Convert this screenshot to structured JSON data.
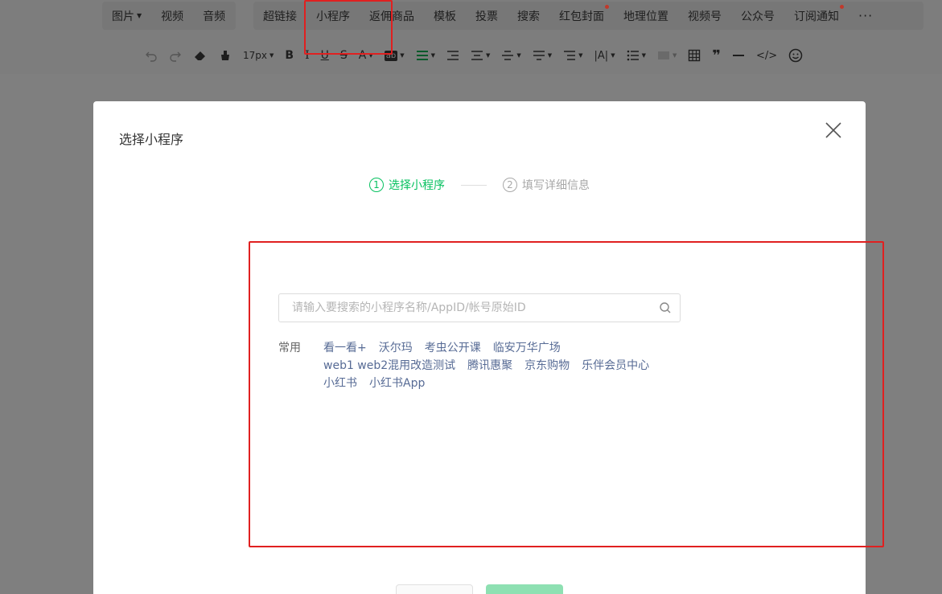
{
  "toolbar": {
    "group1": [
      {
        "label": "图片",
        "has_caret": true
      },
      {
        "label": "视频"
      },
      {
        "label": "音频"
      }
    ],
    "group2": [
      {
        "label": "超链接"
      },
      {
        "label": "小程序"
      },
      {
        "label": "返佣商品"
      },
      {
        "label": "模板"
      },
      {
        "label": "投票"
      },
      {
        "label": "搜索"
      },
      {
        "label": "红包封面",
        "has_dot": true
      },
      {
        "label": "地理位置"
      },
      {
        "label": "视频号"
      },
      {
        "label": "公众号"
      },
      {
        "label": "订阅通知",
        "has_dot": true
      }
    ],
    "more_icon": "more-icon",
    "font_size": "17px"
  },
  "modal": {
    "title": "选择小程序",
    "steps": [
      {
        "num": "1",
        "label": "选择小程序",
        "state": "active"
      },
      {
        "num": "2",
        "label": "填写详细信息",
        "state": "inactive"
      }
    ],
    "search": {
      "placeholder": "请输入要搜索的小程序名称/AppID/帐号原始ID",
      "value": ""
    },
    "recent": {
      "label": "常用",
      "items": [
        "看一看+",
        "沃尔玛",
        "考虫公开课",
        "临安万华广场",
        "web1 web2混用改造测试",
        "腾讯惠聚",
        "京东购物",
        "乐伴会员中心",
        "小红书",
        "小红书App"
      ]
    }
  },
  "colors": {
    "accent": "#07c160",
    "link": "#576b95",
    "annotation": "#e02020",
    "overlay": "#7f7f7f"
  }
}
